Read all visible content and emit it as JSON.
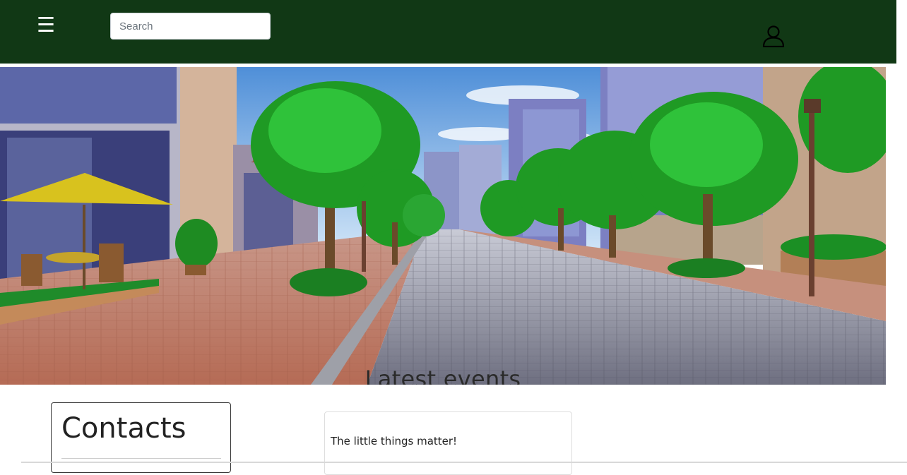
{
  "header": {
    "menu_icon": "hamburger-menu-icon",
    "search_placeholder": "Search",
    "user_icon": "user-profile-icon",
    "background_color": "#113815"
  },
  "hero": {
    "title": "Latest events"
  },
  "contacts": {
    "title": "Contacts"
  },
  "event": {
    "text": "The little things matter!"
  }
}
